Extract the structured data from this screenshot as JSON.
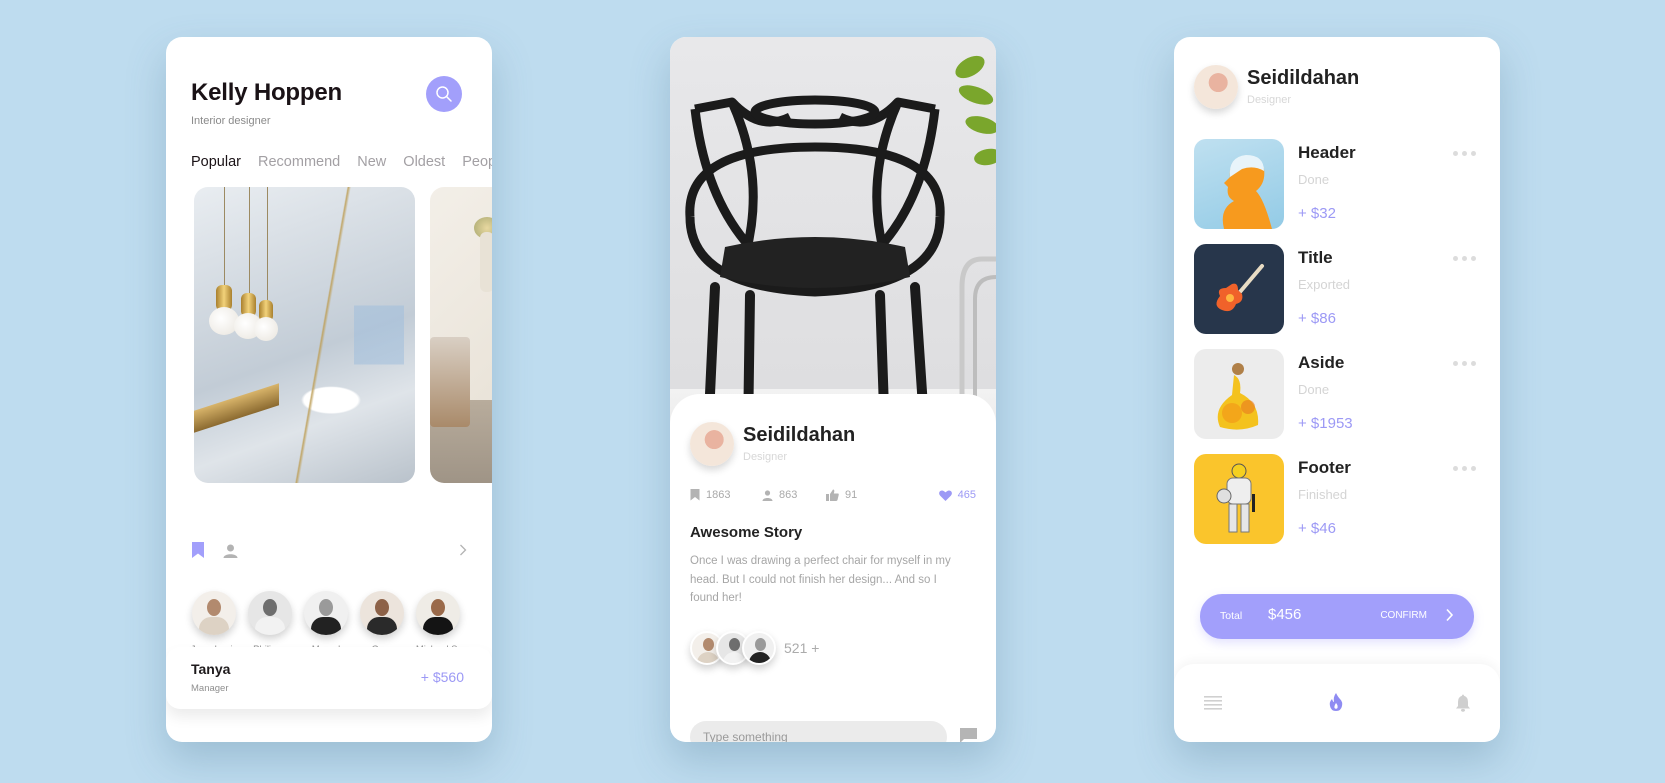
{
  "colors": {
    "background": "#bedcef",
    "accent": "#a29ffb",
    "accent_text": "#9c99f5",
    "text_dark": "#222222",
    "text_muted": "#a6a6a6"
  },
  "screen1": {
    "title": "Kelly Hoppen",
    "subtitle": "Interior designer",
    "search_icon": "search-icon",
    "tabs": [
      {
        "label": "Popular",
        "active": true
      },
      {
        "label": "Recommend",
        "active": false
      },
      {
        "label": "New",
        "active": false
      },
      {
        "label": "Oldest",
        "active": false
      },
      {
        "label": "People",
        "active": false
      }
    ],
    "gallery": [
      {
        "image": "marble-bathroom-photo"
      },
      {
        "image": "living-room-photo"
      }
    ],
    "actions": {
      "bookmark_icon": "bookmark-icon",
      "person_icon": "person-icon",
      "next_icon": "chevron-right-icon"
    },
    "people": [
      {
        "name": "Jean-Louis"
      },
      {
        "name": "Philippe"
      },
      {
        "name": "Marcel"
      },
      {
        "name": "Greg"
      },
      {
        "name": "Michael S."
      }
    ],
    "contact": {
      "name": "Tanya",
      "role": "Manager",
      "amount": "+ $560"
    }
  },
  "screen2": {
    "hero_image": "black-chair-photo",
    "author": {
      "name": "Seidildahan",
      "role": "Designer"
    },
    "stats": {
      "bookmarks": "1863",
      "followers": "863",
      "thumbs": "91",
      "likes": "465"
    },
    "story": {
      "title": "Awesome Story",
      "body": "Once I was drawing a perfect chair for myself in my head. But I could not finish her design... And so I found her!"
    },
    "participants_count": "521 +",
    "comment_placeholder": "Type something",
    "send_icon": "message-icon"
  },
  "screen3": {
    "profile": {
      "name": "Seidildahan",
      "role": "Designer"
    },
    "items": [
      {
        "title": "Header",
        "status": "Done",
        "price": "+ $32",
        "thumb": "orange-silhouette-art"
      },
      {
        "title": "Title",
        "status": "Exported",
        "price": "+ $86",
        "thumb": "guitar-icon-art"
      },
      {
        "title": "Aside",
        "status": "Done",
        "price": "+ $1953",
        "thumb": "watercolor-princess-art"
      },
      {
        "title": "Footer",
        "status": "Finished",
        "price": "+ $46",
        "thumb": "minion-trooper-art"
      }
    ],
    "checkout": {
      "total_label": "Total",
      "total_amount": "$456",
      "confirm_label": "CONFIRM"
    },
    "nav": [
      {
        "icon": "menu-icon",
        "active": false
      },
      {
        "icon": "fire-icon",
        "active": true
      },
      {
        "icon": "bell-icon",
        "active": false
      }
    ]
  }
}
